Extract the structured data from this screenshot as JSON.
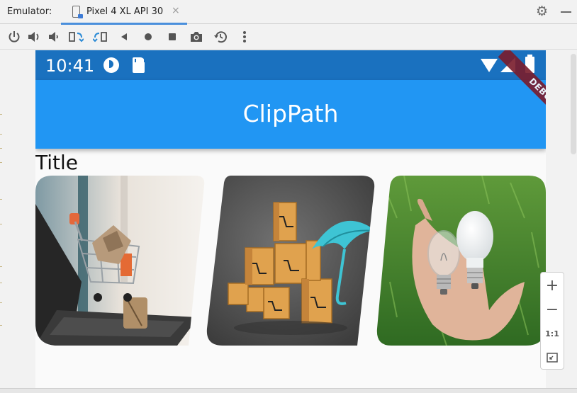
{
  "ide": {
    "emulator_label": "Emulator:",
    "tab_title": "Pixel 4 XL API 30",
    "tab_close": "×"
  },
  "toolbar": {
    "buttons": [
      "power",
      "volume-up",
      "volume-down",
      "rotate-left",
      "rotate-right",
      "back",
      "home",
      "overview",
      "screenshot",
      "snapshot",
      "more"
    ]
  },
  "device": {
    "status_time": "10:41",
    "app_bar_title": "ClipPath",
    "debug_banner": "DEBUG",
    "section_title": "Title",
    "colors": {
      "status_bar": "#1a71bf",
      "app_bar": "#2196f3",
      "debug": "#7a1c2c"
    },
    "cards": [
      {
        "subject": "laptop with shopping cart and parcels"
      },
      {
        "subject": "cardboard boxes with cart icons and umbrella"
      },
      {
        "subject": "hand holding light bulbs over grass"
      }
    ]
  },
  "zoom": {
    "plus": "+",
    "minus": "−",
    "one_to_one": "1:1",
    "fit_icon": "fit-screen-icon"
  }
}
